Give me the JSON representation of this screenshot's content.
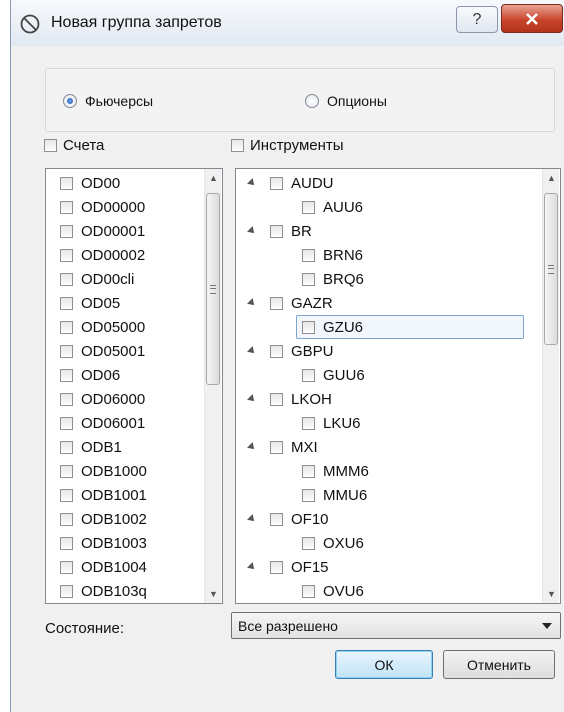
{
  "window": {
    "title": "Новая группа запретов",
    "help_glyph": "?",
    "title_icon": "prohibited-icon"
  },
  "instrument_type": {
    "options": [
      {
        "label": "Фьючерсы",
        "selected": true
      },
      {
        "label": "Опционы",
        "selected": false
      }
    ]
  },
  "accounts": {
    "header": "Счета",
    "items": [
      "OD00",
      "OD00000",
      "OD00001",
      "OD00002",
      "OD00cli",
      "OD05",
      "OD05000",
      "OD05001",
      "OD06",
      "OD06000",
      "OD06001",
      "ODB1",
      "ODB1000",
      "ODB1001",
      "ODB1002",
      "ODB1003",
      "ODB1004",
      "ODB103q"
    ]
  },
  "instruments": {
    "header": "Инструменты",
    "tree": [
      {
        "label": "AUDU",
        "children": [
          "AUU6"
        ]
      },
      {
        "label": "BR",
        "children": [
          "BRN6",
          "BRQ6"
        ]
      },
      {
        "label": "GAZR",
        "children": [
          "GZU6"
        ]
      },
      {
        "label": "GBPU",
        "children": [
          "GUU6"
        ]
      },
      {
        "label": "LKOH",
        "children": [
          "LKU6"
        ]
      },
      {
        "label": "MXI",
        "children": [
          "MMM6",
          "MMU6"
        ]
      },
      {
        "label": "OF10",
        "children": [
          "OXU6"
        ]
      },
      {
        "label": "OF15",
        "children": [
          "OVU6"
        ]
      }
    ],
    "selected_item": "GZU6"
  },
  "state": {
    "label": "Состояние:",
    "value": "Все разрешено"
  },
  "buttons": {
    "ok": "ОК",
    "cancel": "Отменить"
  },
  "colors": {
    "close_button": "#c8452c",
    "selection_border": "#7da2ce"
  }
}
